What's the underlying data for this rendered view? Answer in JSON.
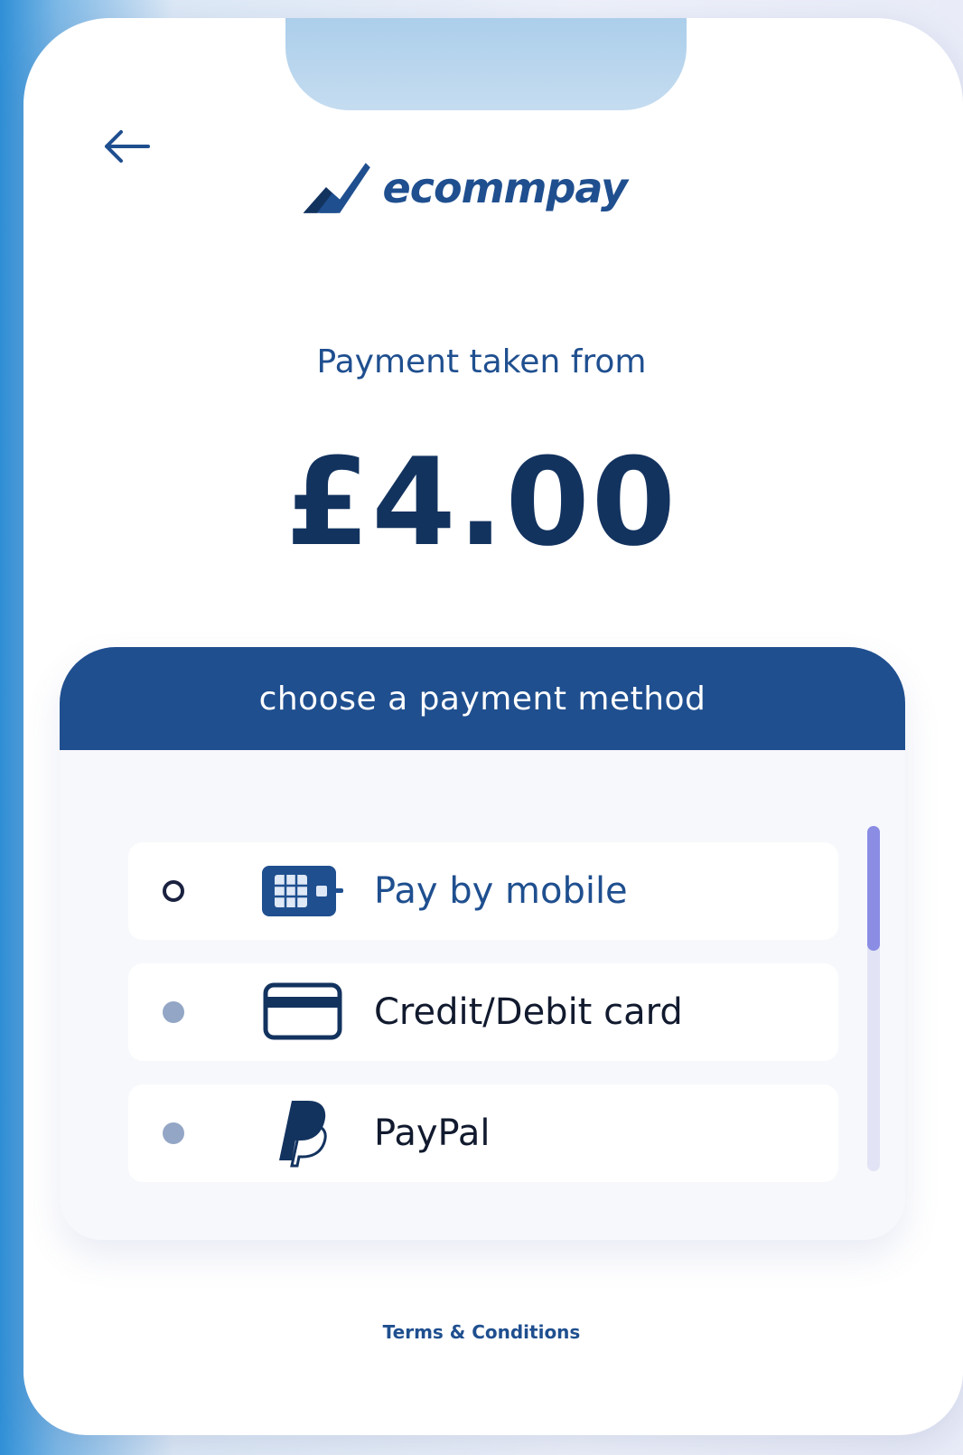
{
  "brand": {
    "name": "ecommpay",
    "color_primary": "#1f4f8f",
    "color_dark": "#13335f",
    "logo_icon": "checkmark-logo-icon"
  },
  "nav": {
    "back_icon": "arrow-left-icon"
  },
  "payment": {
    "subtitle": "Payment taken from",
    "amount": "£4.00"
  },
  "methods_panel": {
    "header": "choose a payment method",
    "items": [
      {
        "label": "Pay by mobile",
        "icon": "sim-card-icon",
        "selected": true
      },
      {
        "label": "Credit/Debit card",
        "icon": "credit-card-icon",
        "selected": false
      },
      {
        "label": "PayPal",
        "icon": "paypal-icon",
        "selected": false
      }
    ]
  },
  "footer": {
    "terms": "Terms & Conditions"
  }
}
